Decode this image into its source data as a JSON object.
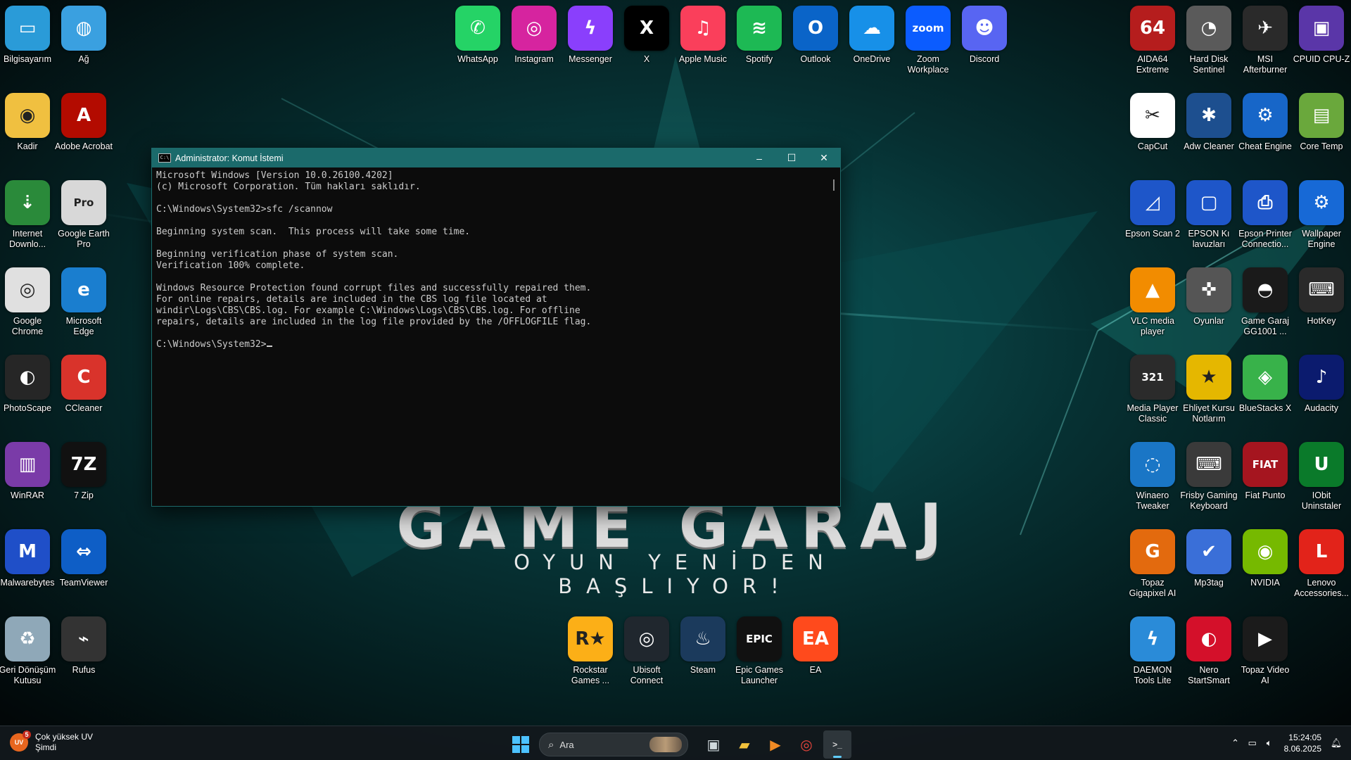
{
  "window": {
    "title": "Administrator: Komut İstemi",
    "console_lines": [
      "Microsoft Windows [Version 10.0.26100.4202]",
      "(c) Microsoft Corporation. Tüm hakları saklıdır.",
      "",
      "C:\\Windows\\System32>sfc /scannow",
      "",
      "Beginning system scan.  This process will take some time.",
      "",
      "Beginning verification phase of system scan.",
      "Verification 100% complete.",
      "",
      "Windows Resource Protection found corrupt files and successfully repaired them.",
      "For online repairs, details are included in the CBS log file located at",
      "windir\\Logs\\CBS\\CBS.log. For example C:\\Windows\\Logs\\CBS\\CBS.log. For offline",
      "repairs, details are included in the log file provided by the /OFFLOGFILE flag.",
      ""
    ],
    "prompt": "C:\\Windows\\System32>",
    "buttons": {
      "minimize": "–",
      "maximize": "☐",
      "close": "✕"
    }
  },
  "wallpaper": {
    "title": "GAME GARAJ",
    "subtitle": "OYUN YENİDEN BAŞLIYOR!"
  },
  "desktop": {
    "left_icons": [
      {
        "label": "Bilgisayarım",
        "icon": "monitor-icon",
        "color": "#2a9bd8",
        "glyph": "▭"
      },
      {
        "label": "Ağ",
        "icon": "network-icon",
        "color": "#3aa0e0",
        "glyph": "◍"
      },
      {
        "label": "Kadir",
        "icon": "user-folder-icon",
        "color": "#f0c040",
        "glyph": "◉"
      },
      {
        "label": "Adobe Acrobat",
        "icon": "acrobat-icon",
        "color": "#b30b00",
        "glyph": "A"
      },
      {
        "label": "Internet Downlo...",
        "icon": "idm-icon",
        "color": "#2a8a3a",
        "glyph": "⇣"
      },
      {
        "label": "Google Earth Pro",
        "icon": "google-earth-icon",
        "color": "#d8d8d8",
        "glyph": "Pro"
      },
      {
        "label": "Google Chrome",
        "icon": "chrome-icon",
        "color": "#e0e0e0",
        "glyph": "◎"
      },
      {
        "label": "Microsoft Edge",
        "icon": "edge-icon",
        "color": "#1a7ecf",
        "glyph": "e"
      },
      {
        "label": "PhotoScape",
        "icon": "photoscape-icon",
        "color": "#262626",
        "glyph": "◐"
      },
      {
        "label": "CCleaner",
        "icon": "ccleaner-icon",
        "color": "#d9332b",
        "glyph": "C"
      },
      {
        "label": "WinRAR",
        "icon": "winrar-icon",
        "color": "#7a3ba8",
        "glyph": "▥"
      },
      {
        "label": "7 Zip",
        "icon": "7zip-icon",
        "color": "#111111",
        "glyph": "7Z"
      },
      {
        "label": "Malwarebytes",
        "icon": "malwarebytes-icon",
        "color": "#1f4fc8",
        "glyph": "M"
      },
      {
        "label": "TeamViewer",
        "icon": "teamviewer-icon",
        "color": "#0e5ec6",
        "glyph": "⇔"
      },
      {
        "label": "Geri Dönüşüm Kutusu",
        "icon": "recycle-bin-icon",
        "color": "#8fa8b8",
        "glyph": "♻"
      },
      {
        "label": "Rufus",
        "icon": "rufus-icon",
        "color": "#333333",
        "glyph": "⌁"
      }
    ],
    "top_icons": [
      {
        "label": "WhatsApp",
        "icon": "whatsapp-icon",
        "color": "#25d366",
        "glyph": "✆"
      },
      {
        "label": "Instagram",
        "icon": "instagram-icon",
        "color": "#d6249f",
        "glyph": "◎"
      },
      {
        "label": "Messenger",
        "icon": "messenger-icon",
        "color": "#8a3ffc",
        "glyph": "ϟ"
      },
      {
        "label": "X",
        "icon": "x-icon",
        "color": "#000000",
        "glyph": "X"
      },
      {
        "label": "Apple Music",
        "icon": "apple-music-icon",
        "color": "#fa3f5b",
        "glyph": "♫"
      },
      {
        "label": "Spotify",
        "icon": "spotify-icon",
        "color": "#1db954",
        "glyph": "≋"
      },
      {
        "label": "Outlook",
        "icon": "outlook-icon",
        "color": "#0a64c8",
        "glyph": "O"
      },
      {
        "label": "OneDrive",
        "icon": "onedrive-icon",
        "color": "#1790e8",
        "glyph": "☁"
      },
      {
        "label": "Zoom Workplace",
        "icon": "zoom-icon",
        "color": "#0b5cff",
        "glyph": "zoom"
      },
      {
        "label": "Discord",
        "icon": "discord-icon",
        "color": "#5865f2",
        "glyph": "☻"
      }
    ],
    "bottom_icons": [
      {
        "label": "Rockstar Games ...",
        "icon": "rockstar-icon",
        "color": "#fcaf17",
        "glyph": "R★"
      },
      {
        "label": "Ubisoft Connect",
        "icon": "ubisoft-icon",
        "color": "#20272e",
        "glyph": "◎"
      },
      {
        "label": "Steam",
        "icon": "steam-icon",
        "color": "#1b3a5c",
        "glyph": "♨"
      },
      {
        "label": "Epic Games Launcher",
        "icon": "epic-games-icon",
        "color": "#111111",
        "glyph": "EPIC"
      },
      {
        "label": "EA",
        "icon": "ea-icon",
        "color": "#ff4a1c",
        "glyph": "EA"
      }
    ],
    "right_icons": [
      {
        "label": "AIDA64 Extreme",
        "icon": "aida64-icon",
        "color": "#b51d1d",
        "glyph": "64"
      },
      {
        "label": "Hard Disk Sentinel",
        "icon": "hard-disk-sentinel-icon",
        "color": "#5a5a5a",
        "glyph": "◔"
      },
      {
        "label": "MSI Afterburner",
        "icon": "msi-afterburner-icon",
        "color": "#2a2a2a",
        "glyph": "✈"
      },
      {
        "label": "CPUID CPU-Z",
        "icon": "cpu-z-icon",
        "color": "#5a36a8",
        "glyph": "▣"
      },
      {
        "label": "CapCut",
        "icon": "capcut-icon",
        "color": "#ffffff",
        "glyph": "✂"
      },
      {
        "label": "Adw Cleaner",
        "icon": "adwcleaner-icon",
        "color": "#1d4f8f",
        "glyph": "✱"
      },
      {
        "label": "Cheat Engine",
        "icon": "cheat-engine-icon",
        "color": "#1766c8",
        "glyph": "⚙"
      },
      {
        "label": "Core Temp",
        "icon": "core-temp-icon",
        "color": "#6aa83c",
        "glyph": "▤"
      },
      {
        "label": "Epson Scan 2",
        "icon": "epson-scan-icon",
        "color": "#1e56c9",
        "glyph": "◿"
      },
      {
        "label": "EPSON Kı lavuzları",
        "icon": "epson-manuals-icon",
        "color": "#1e56c9",
        "glyph": "▢"
      },
      {
        "label": "Epson Printer Connectio...",
        "icon": "epson-printer-icon",
        "color": "#1e56c9",
        "glyph": "⎙"
      },
      {
        "label": "Wallpaper Engine",
        "icon": "wallpaper-engine-icon",
        "color": "#1769d6",
        "glyph": "⚙"
      },
      {
        "label": "VLC media player",
        "icon": "vlc-icon",
        "color": "#f28c00",
        "glyph": "▲"
      },
      {
        "label": "Oyunlar",
        "icon": "gamepad-icon",
        "color": "#555555",
        "glyph": "✜"
      },
      {
        "label": "Game Garaj GG1001 ...",
        "icon": "game-garaj-icon",
        "color": "#1a1a1a",
        "glyph": "◓"
      },
      {
        "label": "HotKey",
        "icon": "hotkey-icon",
        "color": "#2a2a2a",
        "glyph": "⌨"
      },
      {
        "label": "Media Player Classic",
        "icon": "media-player-classic-icon",
        "color": "#2b2b2b",
        "glyph": "321"
      },
      {
        "label": "Ehliyet Kursu Notlarım",
        "icon": "star-icon",
        "color": "#e5b700",
        "glyph": "★"
      },
      {
        "label": "BlueStacks X",
        "icon": "bluestacks-icon",
        "color": "#38b24a",
        "glyph": "◈"
      },
      {
        "label": "Audacity",
        "icon": "audacity-icon",
        "color": "#0b1b6e",
        "glyph": "♪"
      },
      {
        "label": "Winaero Tweaker",
        "icon": "winaero-icon",
        "color": "#1a76c6",
        "glyph": "◌"
      },
      {
        "label": "Frisby Gaming Keyboard",
        "icon": "keyboard-icon",
        "color": "#3a3a3a",
        "glyph": "⌨"
      },
      {
        "label": "Fiat Punto",
        "icon": "fiat-icon",
        "color": "#a5151f",
        "glyph": "FIAT"
      },
      {
        "label": "IObit Uninstaler",
        "icon": "iobit-icon",
        "color": "#0a7a2a",
        "glyph": "U"
      },
      {
        "label": "Topaz Gigapixel AI",
        "icon": "topaz-gigapixel-icon",
        "color": "#e36a0e",
        "glyph": "G"
      },
      {
        "label": "Mp3tag",
        "icon": "mp3tag-icon",
        "color": "#3a6fd8",
        "glyph": "✔"
      },
      {
        "label": "NVIDIA",
        "icon": "nvidia-icon",
        "color": "#76b900",
        "glyph": "◉"
      },
      {
        "label": "Lenovo Accessories...",
        "icon": "lenovo-icon",
        "color": "#e2231a",
        "glyph": "L"
      },
      {
        "label": "DAEMON Tools Lite",
        "icon": "daemon-tools-icon",
        "color": "#2a8bd8",
        "glyph": "ϟ"
      },
      {
        "label": "Nero StartSmart",
        "icon": "nero-icon",
        "color": "#d4102a",
        "glyph": "◐"
      },
      {
        "label": "Topaz Video AI",
        "icon": "topaz-video-icon",
        "color": "#1b1b1b",
        "glyph": "▶"
      }
    ]
  },
  "taskbar": {
    "weather_line1": "Çok yüksek UV",
    "weather_line2": "Şimdi",
    "weather_badge": "5",
    "weather_icon_text": "UV",
    "search_placeholder": "Ara",
    "time": "15:24:05",
    "date": "8.06.2025",
    "apps": [
      {
        "name": "task-view-icon",
        "glyph": "▣",
        "color": "#cfd8dc"
      },
      {
        "name": "file-explorer-icon",
        "glyph": "▰",
        "color": "#f2c23c"
      },
      {
        "name": "media-player-icon",
        "glyph": "▶",
        "color": "#f08a24"
      },
      {
        "name": "chrome-icon",
        "glyph": "◎",
        "color": "#e8453c"
      },
      {
        "name": "terminal-icon",
        "glyph": ">_",
        "color": "#d0d0d0"
      }
    ]
  },
  "colors": {
    "accent": "#60cdff",
    "titlebar": "#1b6a6b"
  }
}
